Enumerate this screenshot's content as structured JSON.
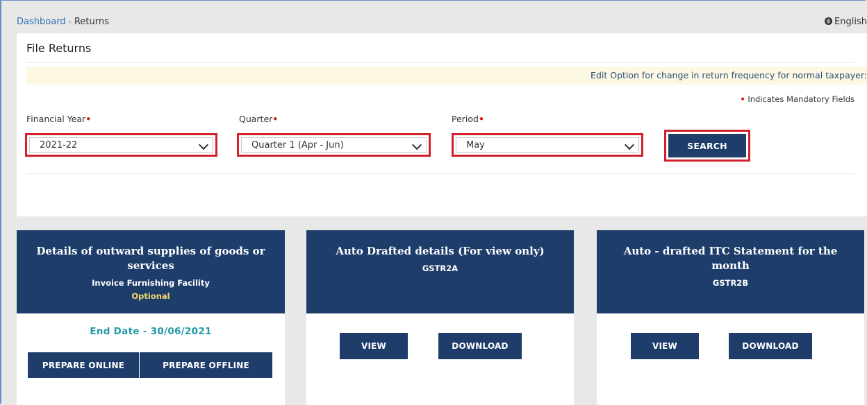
{
  "breadcrumb": {
    "home": "Dashboard",
    "current": "Returns"
  },
  "language": "English",
  "page_title": "File Returns",
  "notice": "Edit Option for change in return frequency for normal taxpayer:",
  "mandatory_note": "Indicates Mandatory Fields",
  "filters": {
    "financial_year": {
      "label": "Financial Year",
      "value": "2021-22"
    },
    "quarter": {
      "label": "Quarter",
      "value": "Quarter 1 (Apr - Jun)"
    },
    "period": {
      "label": "Period",
      "value": "May"
    },
    "search_label": "SEARCH"
  },
  "tiles": [
    {
      "title": "Details of outward supplies of goods or services",
      "subtitle": "Invoice Furnishing Facility",
      "tag": "Optional",
      "end_date": "End Date - 30/06/2021",
      "buttons": [
        "PREPARE ONLINE",
        "PREPARE OFFLINE"
      ]
    },
    {
      "title": "Auto Drafted details (For view only)",
      "subtitle": "GSTR2A",
      "buttons": [
        "VIEW",
        "DOWNLOAD"
      ]
    },
    {
      "title": "Auto - drafted ITC Statement for the month",
      "subtitle": "GSTR2B",
      "buttons": [
        "VIEW",
        "DOWNLOAD"
      ]
    }
  ],
  "colors": {
    "primary": "#1e3d6b",
    "highlight_border": "#d4202c",
    "end_date": "#1e9aa5",
    "optional": "#f3d96a",
    "notice_bg": "#fcf8e3"
  }
}
